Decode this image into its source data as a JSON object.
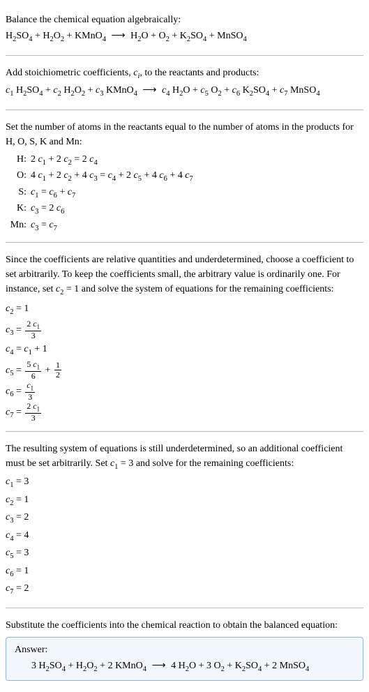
{
  "s1": {
    "title": "Balance the chemical equation algebraically:",
    "eq_l1": "H",
    "eq_l2": "2",
    "eq_l3": "SO",
    "eq_l4": "4",
    "eq_l5": " + H",
    "eq_l6": "2",
    "eq_l7": "O",
    "eq_l8": "2",
    "eq_l9": " + KMnO",
    "eq_l10": "4",
    "arrow": "⟶",
    "eq_r1": "H",
    "eq_r2": "2",
    "eq_r3": "O + O",
    "eq_r4": "2",
    "eq_r5": " + K",
    "eq_r6": "2",
    "eq_r7": "SO",
    "eq_r8": "4",
    "eq_r9": " + MnSO",
    "eq_r10": "4"
  },
  "s2": {
    "intro1": "Add stoichiometric coefficients, ",
    "ci": "c",
    "cisub": "i",
    "intro2": ", to the reactants and products:",
    "c1": "c",
    "n1": "1",
    "sp1": " H",
    "sb1": "2",
    "sp2": "SO",
    "sb2": "4",
    "plus1": " + ",
    "c2": "c",
    "n2": "2",
    "sp3": " H",
    "sb3": "2",
    "sp4": "O",
    "sb4": "2",
    "plus2": " + ",
    "c3": "c",
    "n3": "3",
    "sp5": " KMnO",
    "sb5": "4",
    "arrow": "⟶",
    "c4": "c",
    "n4": "4",
    "sp6": " H",
    "sb6": "2",
    "sp7": "O + ",
    "c5": "c",
    "n5": "5",
    "sp8": " O",
    "sb7": "2",
    "plus3": " + ",
    "c6": "c",
    "n6": "6",
    "sp9": " K",
    "sb8": "2",
    "sp10": "SO",
    "sb9": "4",
    "plus4": " + ",
    "c7": "c",
    "n7": "7",
    "sp11": " MnSO",
    "sb10": "4"
  },
  "s3": {
    "intro": "Set the number of atoms in the reactants equal to the number of atoms in the products for H, O, S, K and Mn:",
    "rows": [
      {
        "label": "H:",
        "lhs1": "2 ",
        "c1": "c",
        "s1": "1",
        "mid1": " + 2 ",
        "c2": "c",
        "s2": "2",
        "eq": " = 2 ",
        "c3": "c",
        "s3": "4",
        "tail": ""
      },
      {
        "label": "O:",
        "lhs1": "4 ",
        "c1": "c",
        "s1": "1",
        "mid1": " + 2 ",
        "c2": "c",
        "s2": "2",
        "mid2": " + 4 ",
        "c3": "c",
        "s3": "3",
        "eq": " = ",
        "c4": "c",
        "s4": "4",
        "mid3": " + 2 ",
        "c5": "c",
        "s5": "5",
        "mid4": " + 4 ",
        "c6": "c",
        "s6": "6",
        "mid5": " + 4 ",
        "c7": "c",
        "s7": "7"
      },
      {
        "label": "S:",
        "c1": "c",
        "s1": "1",
        "eq": " = ",
        "c2": "c",
        "s2": "6",
        "mid1": " + ",
        "c3": "c",
        "s3": "7"
      },
      {
        "label": "K:",
        "c1": "c",
        "s1": "3",
        "eq": " = 2 ",
        "c2": "c",
        "s2": "6"
      },
      {
        "label": "Mn:",
        "c1": "c",
        "s1": "3",
        "eq": " = ",
        "c2": "c",
        "s2": "7"
      }
    ]
  },
  "s4": {
    "intro1": "Since the coefficients are relative quantities and underdetermined, choose a coefficient to set arbitrarily. To keep the coefficients small, the arbitrary value is ordinarily one. For instance, set ",
    "cset": "c",
    "csetsub": "2",
    "csetval": " = 1",
    "intro2": " and solve the system of equations for the remaining coefficients:",
    "l1_c": "c",
    "l1_s": "2",
    "l1_v": " = 1",
    "l2_c": "c",
    "l2_s": "3",
    "l2_eq": " = ",
    "l2_num1": "2 ",
    "l2_numc": "c",
    "l2_nums": "1",
    "l2_den": "3",
    "l3_c": "c",
    "l3_s": "4",
    "l3_eq": " = ",
    "l3_rc": "c",
    "l3_rs": "1",
    "l3_rt": " + 1",
    "l4_c": "c",
    "l4_s": "5",
    "l4_eq": " = ",
    "l4_num1": "5 ",
    "l4_numc": "c",
    "l4_nums": "1",
    "l4_den": "6",
    "l4_plus": " + ",
    "l4_n2": "1",
    "l4_d2": "2",
    "l5_c": "c",
    "l5_s": "6",
    "l5_eq": " = ",
    "l5_numc": "c",
    "l5_nums": "1",
    "l5_den": "3",
    "l6_c": "c",
    "l6_s": "7",
    "l6_eq": " = ",
    "l6_num1": "2 ",
    "l6_numc": "c",
    "l6_nums": "1",
    "l6_den": "3"
  },
  "s5": {
    "intro1": "The resulting system of equations is still underdetermined, so an additional coefficient must be set arbitrarily. Set ",
    "cset": "c",
    "csetsub": "1",
    "csetval": " = 3",
    "intro2": " and solve for the remaining coefficients:",
    "rows": [
      {
        "c": "c",
        "s": "1",
        "v": " = 3"
      },
      {
        "c": "c",
        "s": "2",
        "v": " = 1"
      },
      {
        "c": "c",
        "s": "3",
        "v": " = 2"
      },
      {
        "c": "c",
        "s": "4",
        "v": " = 4"
      },
      {
        "c": "c",
        "s": "5",
        "v": " = 3"
      },
      {
        "c": "c",
        "s": "6",
        "v": " = 1"
      },
      {
        "c": "c",
        "s": "7",
        "v": " = 2"
      }
    ]
  },
  "s6": {
    "intro": "Substitute the coefficients into the chemical reaction to obtain the balanced equation:",
    "answer_title": "Answer:",
    "a1": "3 H",
    "as1": "2",
    "a2": "SO",
    "as2": "4",
    "a3": " + H",
    "as3": "2",
    "a4": "O",
    "as4": "2",
    "a5": " + 2 KMnO",
    "as5": "4",
    "arrow": "⟶",
    "b1": "4 H",
    "bs1": "2",
    "b2": "O + 3 O",
    "bs2": "2",
    "b3": " + K",
    "bs3": "2",
    "b4": "SO",
    "bs4": "4",
    "b5": " + 2 MnSO",
    "bs5": "4"
  }
}
